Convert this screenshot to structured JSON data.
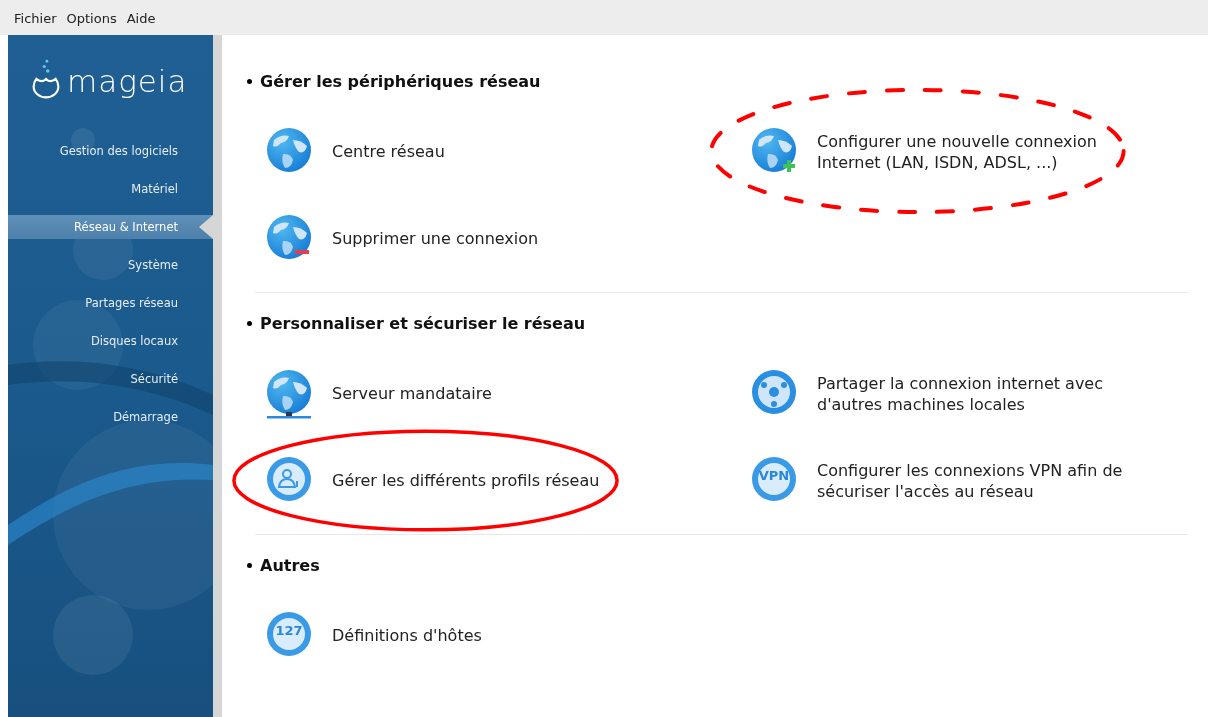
{
  "menu_bar": [
    "Fichier",
    "Options",
    "Aide"
  ],
  "sidebar": {
    "logo": "mageia",
    "items": [
      {
        "label": "Gestion des logiciels",
        "selected": false
      },
      {
        "label": "Matériel",
        "selected": false
      },
      {
        "label": "Réseau & Internet",
        "selected": true
      },
      {
        "label": "Système",
        "selected": false
      },
      {
        "label": "Partages réseau",
        "selected": false
      },
      {
        "label": "Disques locaux",
        "selected": false
      },
      {
        "label": "Sécurité",
        "selected": false
      },
      {
        "label": "Démarrage",
        "selected": false
      }
    ]
  },
  "sections": [
    {
      "title": "Gérer les périphériques réseau",
      "items": [
        {
          "label": "Centre réseau",
          "kind": "globe"
        },
        {
          "label": "Configurer une nouvelle connexion Internet (LAN, ISDN, ADSL, ...)",
          "kind": "globe-add",
          "annotation": {
            "kind": "dashed"
          }
        },
        {
          "label": "Supprimer une connexion",
          "kind": "globe-remove"
        }
      ]
    },
    {
      "title": "Personnaliser et sécuriser le réseau",
      "items": [
        {
          "label": "Serveur mandataire",
          "kind": "globe-server"
        },
        {
          "label": "Partager la connexion internet avec d'autres machines locales",
          "kind": "share"
        },
        {
          "label": "Gérer les différents profils réseau",
          "kind": "profile",
          "annotation": {
            "kind": "solid"
          }
        },
        {
          "label": "Configurer les connexions VPN afin de sécuriser l'accès au réseau",
          "kind": "badge",
          "icon_text": "VPN"
        }
      ]
    },
    {
      "title": "Autres",
      "items": [
        {
          "label": "Définitions d'hôtes",
          "kind": "badge",
          "icon_text": "127"
        }
      ]
    }
  ]
}
